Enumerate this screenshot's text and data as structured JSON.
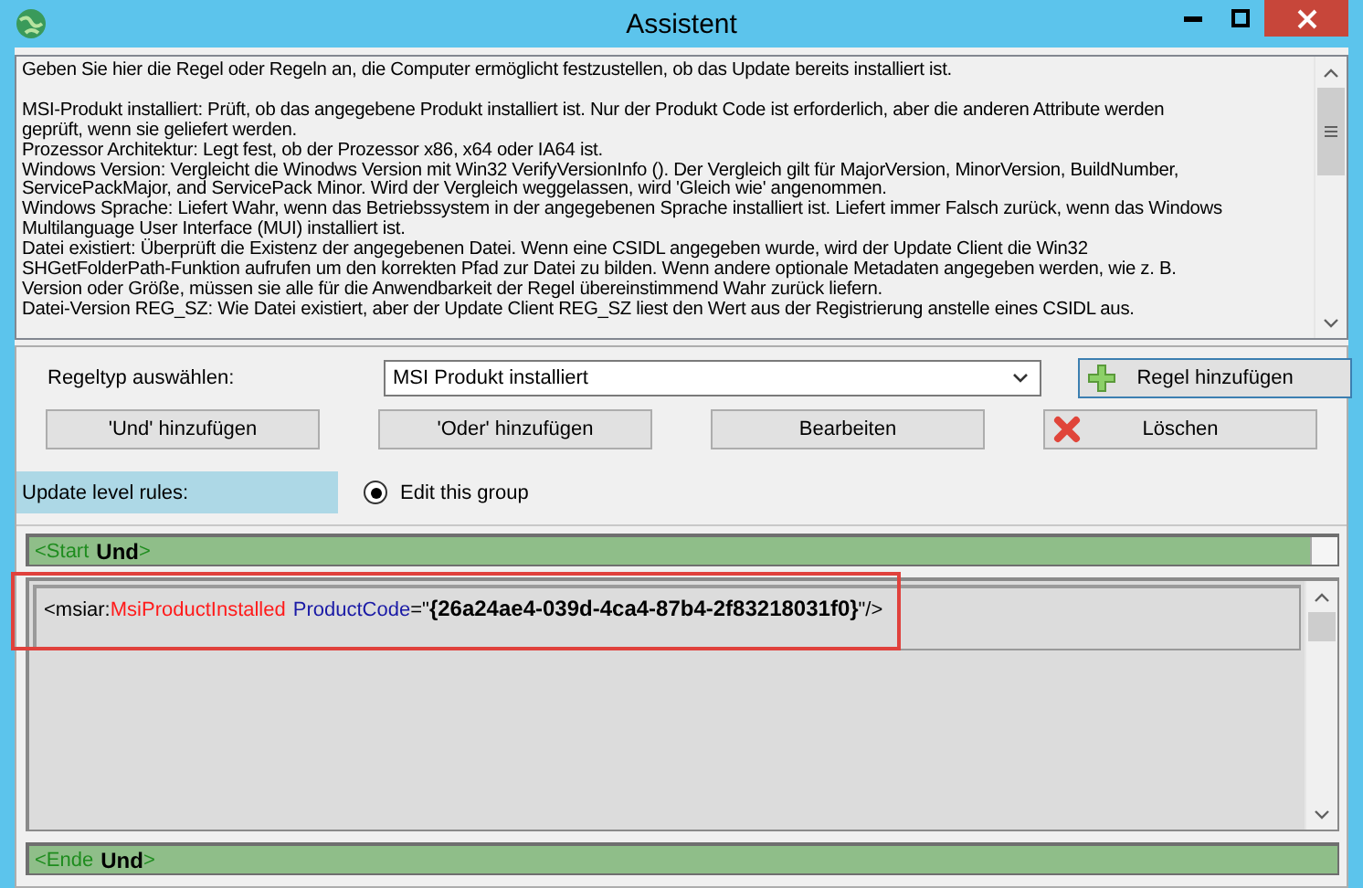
{
  "window": {
    "title": "Assistent"
  },
  "description": {
    "paragraphs": [
      {
        "lines": [
          "Geben Sie hier die Regel oder Regeln an, die Computer ermöglicht festzustellen, ob das Update bereits installiert ist."
        ]
      },
      {
        "lines": [
          "MSI-Produkt installiert: Prüft, ob das angegebene Produkt installiert ist. Nur der Produkt Code ist erforderlich, aber die anderen Attribute werden",
          "geprüft, wenn sie geliefert werden."
        ]
      },
      {
        "lines": [
          "Prozessor Architektur: Legt fest, ob der Prozessor x86, x64 oder IA64 ist."
        ]
      },
      {
        "lines": [
          "Windows Version: Vergleicht die Winodws Version mit Win32 VerifyVersionInfo (). Der Vergleich gilt für MajorVersion, MinorVersion, BuildNumber,",
          "ServicePackMajor, and ServicePack Minor.  Wird der Vergleich weggelassen, wird 'Gleich wie' angenommen."
        ]
      },
      {
        "lines": [
          "Windows Sprache: Liefert Wahr, wenn das Betriebssystem in der angegebenen Sprache installiert ist. Liefert immer Falsch zurück, wenn das Windows",
          "Multilanguage User Interface (MUI) installiert ist."
        ]
      },
      {
        "lines": [
          "Datei existiert: Überprüft die Existenz der angegebenen Datei. Wenn eine CSIDL angegeben wurde, wird der Update Client die Win32",
          "SHGetFolderPath-Funktion aufrufen um den korrekten Pfad zur Datei zu bilden. Wenn andere optionale Metadaten angegeben werden, wie z. B.",
          "Version oder Größe, müssen sie alle für die Anwendbarkeit der Regel übereinstimmend Wahr zurück liefern."
        ]
      },
      {
        "lines": [
          "Datei-Version REG_SZ: Wie Datei existiert, aber der Update Client REG_SZ liest den Wert aus der Registrierung anstelle eines CSIDL aus."
        ]
      }
    ]
  },
  "rule_type": {
    "label": "Regeltyp auswählen:",
    "value": "MSI Produkt installiert"
  },
  "buttons": [
    {
      "label": "Regel hinzufügen",
      "kind": "add",
      "focused": true
    },
    {
      "label": "'Und' hinzufügen",
      "kind": "plain",
      "focused": false
    },
    {
      "label": "'Oder' hinzufügen",
      "kind": "plain",
      "focused": false
    },
    {
      "label": "Bearbeiten",
      "kind": "plain",
      "focused": false
    },
    {
      "label": "Löschen",
      "kind": "delete",
      "focused": false
    }
  ],
  "update_level": {
    "label": "Update level rules:",
    "option": "Edit this group",
    "selected": true
  },
  "start": [
    {
      "kind": "tag",
      "text": "<Start"
    },
    {
      "kind": "keyword",
      "text": "Und"
    },
    {
      "kind": "tag",
      "text": ">"
    }
  ],
  "rule": {
    "highlighted": true,
    "parts": [
      {
        "kind": "plain",
        "text": "<msiar:"
      },
      {
        "kind": "element",
        "text": "MsiProductInstalled"
      },
      {
        "kind": "attribute",
        "text": "ProductCode"
      },
      {
        "kind": "plain",
        "text": "=\""
      },
      {
        "kind": "value",
        "text": "{26a24ae4-039d-4ca4-87b4-2f83218031f0}"
      },
      {
        "kind": "plain",
        "text": "\"/>"
      }
    ]
  },
  "end": [
    {
      "kind": "tag",
      "text": "<Ende"
    },
    {
      "kind": "keyword",
      "text": "Und"
    },
    {
      "kind": "tag",
      "text": ">"
    }
  ]
}
